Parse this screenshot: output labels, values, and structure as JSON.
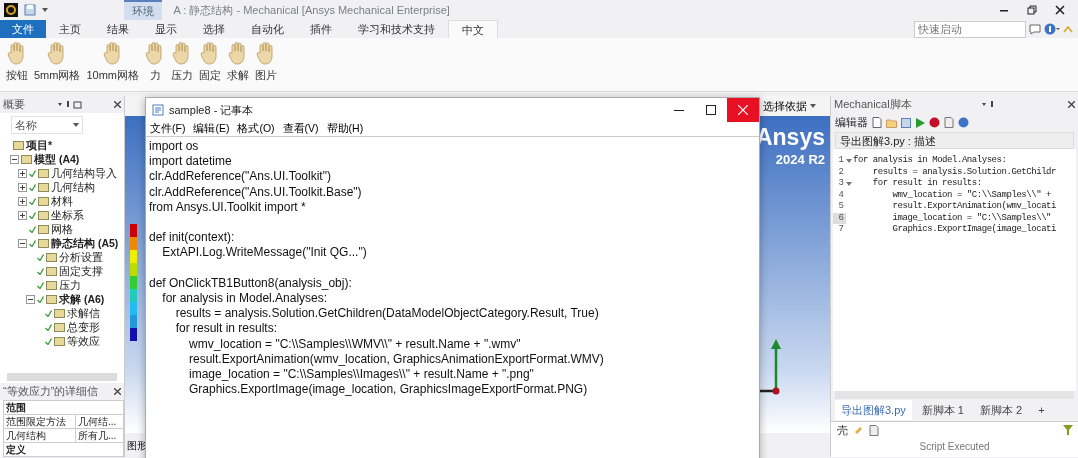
{
  "app_window": {
    "context_tab": "环境",
    "title": "A : 静态结构 - Mechanical [Ansys Mechanical Enterprise]"
  },
  "ribbon": {
    "tabs": [
      {
        "label": "文件",
        "kind": "file",
        "selected": false
      },
      {
        "label": "主页",
        "kind": "tab",
        "selected": false
      },
      {
        "label": "结果",
        "kind": "tab",
        "selected": false
      },
      {
        "label": "显示",
        "kind": "tab",
        "selected": false
      },
      {
        "label": "选择",
        "kind": "tab",
        "selected": false
      },
      {
        "label": "自动化",
        "kind": "tab",
        "selected": false
      },
      {
        "label": "插件",
        "kind": "tab",
        "selected": false
      },
      {
        "label": "学习和技术支持",
        "kind": "tab",
        "selected": false
      },
      {
        "label": "中文",
        "kind": "tab",
        "selected": true
      }
    ],
    "search": {
      "placeholder": "快速启动"
    },
    "buttons": [
      {
        "label": "按钮"
      },
      {
        "label": "5mm网格"
      },
      {
        "label": "10mm网格"
      },
      {
        "label": "力"
      },
      {
        "label": "压力"
      },
      {
        "label": "固定"
      },
      {
        "label": "求解"
      },
      {
        "label": "图片"
      }
    ]
  },
  "outline": {
    "title": "概要",
    "filter": "名称",
    "tree": [
      {
        "label": "项目*",
        "bold": true,
        "checked": false,
        "children": [
          {
            "label": "模型 (A4)",
            "bold": true,
            "checked": false,
            "expanded": true,
            "children": [
              {
                "label": "几何结构导入",
                "bold": false,
                "checked": true,
                "expanded": false
              },
              {
                "label": "几何结构",
                "bold": false,
                "checked": true,
                "expanded": false
              },
              {
                "label": "材料",
                "bold": false,
                "checked": true,
                "expanded": false
              },
              {
                "label": "坐标系",
                "bold": false,
                "checked": true,
                "expanded": false
              },
              {
                "label": "网格",
                "bold": false,
                "checked": true
              },
              {
                "label": "静态结构 (A5)",
                "bold": true,
                "checked": true,
                "expanded": true,
                "children": [
                  {
                    "label": "分析设置",
                    "bold": false,
                    "checked": true
                  },
                  {
                    "label": "固定支撑",
                    "bold": false,
                    "checked": true
                  },
                  {
                    "label": "压力",
                    "bold": false,
                    "checked": true
                  },
                  {
                    "label": "求解 (A6)",
                    "bold": true,
                    "checked": true,
                    "expanded": true,
                    "children": [
                      {
                        "label": "求解信",
                        "bold": false,
                        "checked": true
                      },
                      {
                        "label": "总变形",
                        "bold": false,
                        "checked": true
                      },
                      {
                        "label": "等效应",
                        "bold": false,
                        "checked": true
                      }
                    ]
                  }
                ]
              }
            ]
          }
        ]
      }
    ]
  },
  "details": {
    "title": "“等效应力”的详细信",
    "groups": [
      {
        "label": "范围",
        "expanded": true,
        "rows": [
          [
            "范围限定方法",
            "几何结..."
          ],
          [
            "几何结构",
            "所有几..."
          ]
        ]
      },
      {
        "label": "定义",
        "expanded": true
      }
    ]
  },
  "viewport": {
    "toolbar_label": "选择依据",
    "logo": "Ansys",
    "version": "2024 R2",
    "bottom_tab": "图形"
  },
  "notepad": {
    "title": "sample8 - 记事本",
    "close_hovered": true,
    "menu": [
      "文件(F)",
      "编辑(E)",
      "格式(O)",
      "查看(V)",
      "帮助(H)"
    ],
    "paragraphs": [
      [
        "import os",
        "import datetime",
        "clr.AddReference(\"Ans.UI.Toolkit\")",
        "clr.AddReference(\"Ans.UI.Toolkit.Base\")",
        "from Ansys.UI.Toolkit import *"
      ],
      [
        "def init(context):",
        "    ExtAPI.Log.WriteMessage(\"Init QG...\")"
      ],
      [
        "def OnClickTB1Button8(analysis_obj):",
        "    for analysis in Model.Analyses:",
        "        results = analysis.Solution.GetChildren(DataModelObjectCategory.Result, True)",
        "        for result in results:",
        "            wmv_location = \"C:\\\\Samples\\\\WMV\\\\\" + result.Name + \".wmv\"",
        "            result.ExportAnimation(wmv_location, GraphicsAnimationExportFormat.WMV)",
        "            image_location = \"C:\\\\Samples\\\\Images\\\\\" + result.Name + \".png\"",
        "            Graphics.ExportImage(image_location, GraphicsImageExportFormat.PNG)"
      ]
    ]
  },
  "script_panel": {
    "title": "Mechanical脚本",
    "toolbar_label": "编辑器",
    "file_header": "导出图解3.py : 描述",
    "code": [
      {
        "number": "1",
        "foldable": true,
        "current": false,
        "text": "for analysis in Model.Analyses:"
      },
      {
        "number": "2",
        "foldable": false,
        "current": false,
        "text": "    results = analysis.Solution.GetChildr"
      },
      {
        "number": "3",
        "foldable": true,
        "current": false,
        "text": "    for result in results:"
      },
      {
        "number": "4",
        "foldable": false,
        "current": false,
        "text": "        wmv_location = \"C:\\\\Samples\\\\\" +"
      },
      {
        "number": "5",
        "foldable": false,
        "current": false,
        "text": "        result.ExportAnimation(wmv_locati"
      },
      {
        "number": "6",
        "foldable": false,
        "current": true,
        "text": "        image_location = \"C:\\\\Samples\\\\\""
      },
      {
        "number": "7",
        "foldable": false,
        "current": false,
        "text": "        Graphics.ExportImage(image_locati"
      }
    ],
    "tabs": [
      {
        "label": "导出图解3.py",
        "selected": true
      },
      {
        "label": "新脚本 1",
        "selected": false
      },
      {
        "label": "新脚本 2",
        "selected": false
      }
    ],
    "add_tab": "+"
  },
  "shell": {
    "label": "壳",
    "message": "Script Executed"
  }
}
